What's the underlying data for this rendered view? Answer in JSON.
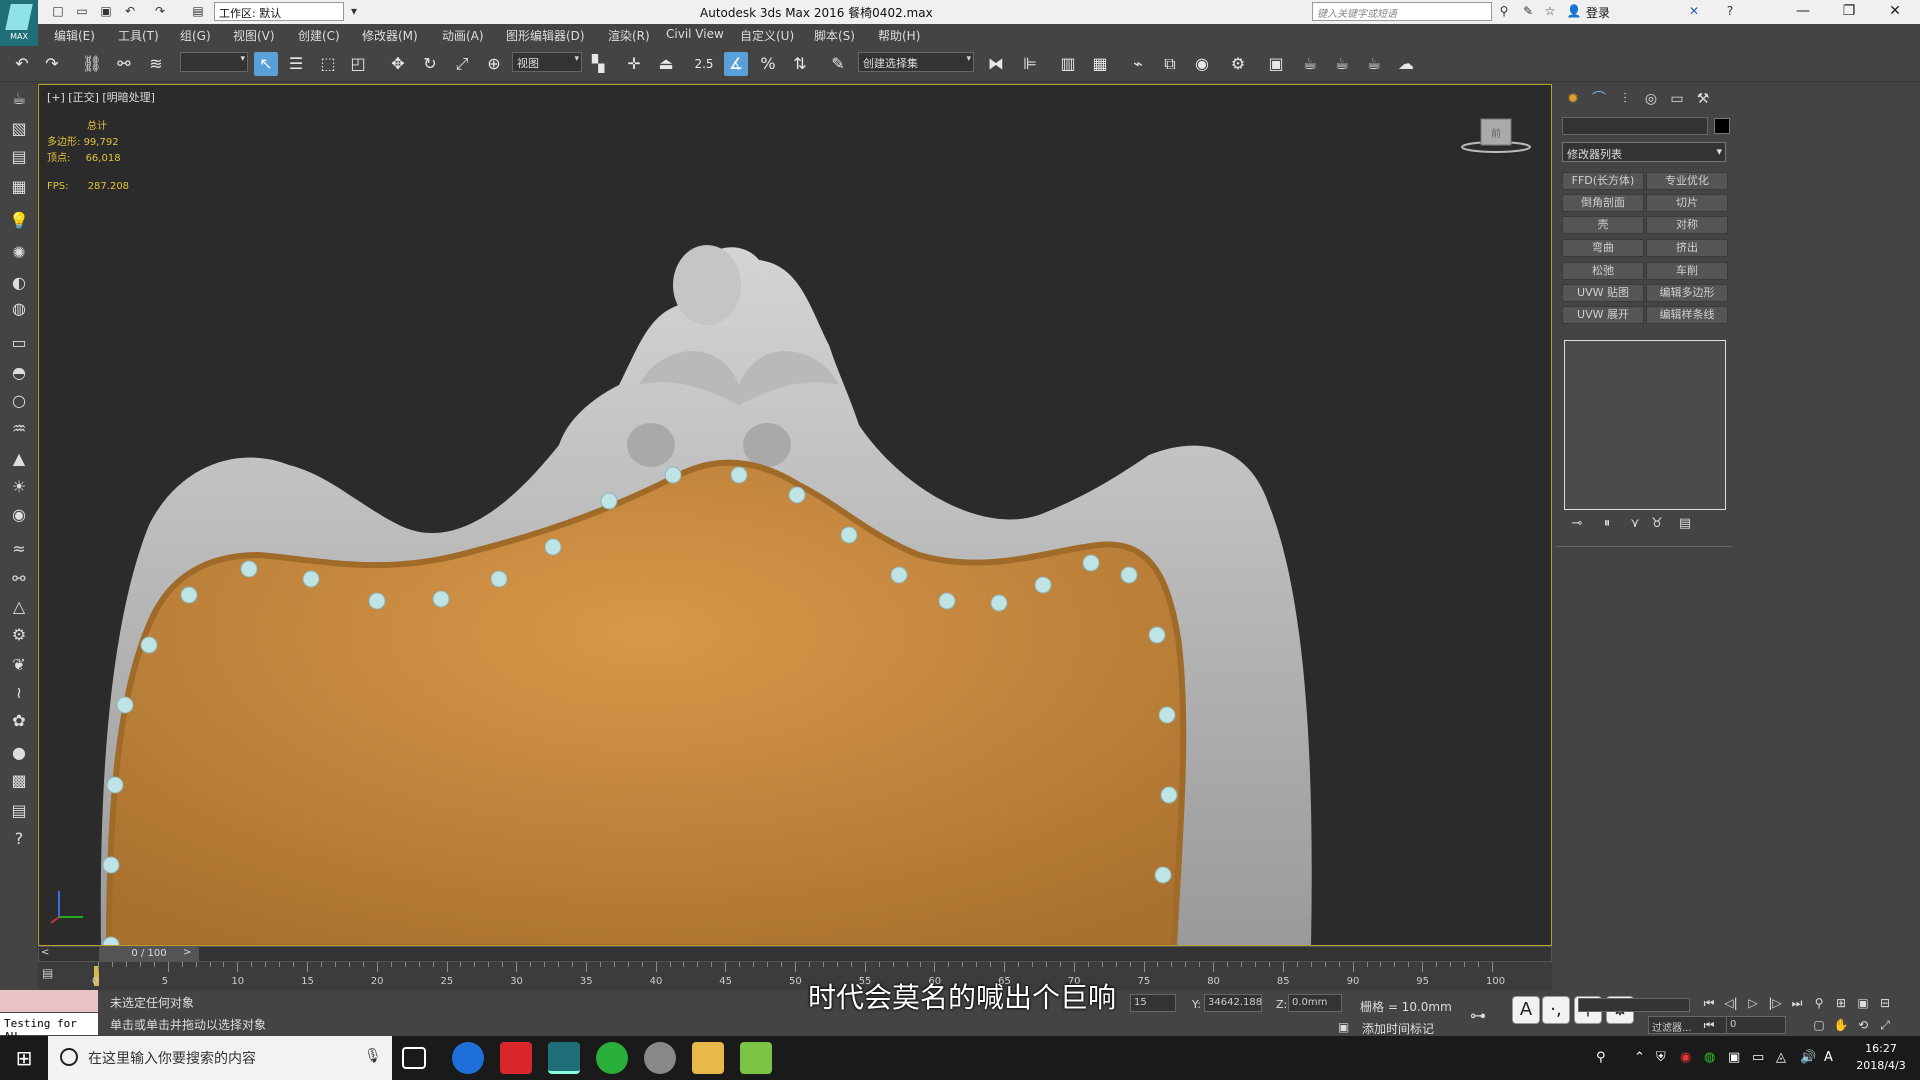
{
  "titlebar": {
    "workspace": "工作区: 默认",
    "title": "Autodesk 3ds Max 2016       餐椅0402.max",
    "search_placeholder": "键入关键字或短语",
    "login": "登录",
    "logo_text": "MAX"
  },
  "menu": [
    "编辑(E)",
    "工具(T)",
    "组(G)",
    "视图(V)",
    "创建(C)",
    "修改器(M)",
    "动画(A)",
    "图形编辑器(D)",
    "渲染(R)",
    "Civil View",
    "自定义(U)",
    "脚本(S)",
    "帮助(H)"
  ],
  "toolbar": {
    "view_dropdown": "视图",
    "snap_value": "2.5",
    "selection_set": "创建选择集"
  },
  "viewport": {
    "label": "[+] [正交] [明暗处理]",
    "stats_header": "总计",
    "polys_label": "多边形:",
    "polys": "99,792",
    "verts_label": "顶点:",
    "verts": "66,018",
    "fps_label": "FPS:",
    "fps": "287.208",
    "viewcube_label": "前"
  },
  "command_panel": {
    "modifier_list": "修改器列表",
    "buttons": [
      "FFD(长方体)",
      "专业优化",
      "倒角剖面",
      "切片",
      "壳",
      "对称",
      "弯曲",
      "挤出",
      "松弛",
      "车削",
      "UVW 贴图",
      "编辑多边形",
      "UVW 展开",
      "编辑样条线"
    ]
  },
  "timeline": {
    "frame": "0 / 100",
    "ticks": [
      "0",
      "5",
      "10",
      "15",
      "20",
      "25",
      "30",
      "35",
      "40",
      "45",
      "50",
      "55",
      "60",
      "65",
      "70",
      "75",
      "80",
      "85",
      "90",
      "95",
      "100"
    ]
  },
  "status": {
    "line1": "未选定任何对象",
    "line2": "单击或单击并拖动以选择对象",
    "testing": "Testing for AU",
    "x_val": "15",
    "y_label": "Y:",
    "y_val": "34642.188",
    "z_label": "Z:",
    "z_val": "0.0mm",
    "grid": "栅格 = 10.0mm",
    "add_time_tag": "添加时间标记",
    "filter": "过滤器...",
    "frame_input": "0"
  },
  "subtitle": "时代会莫名的喊出个巨响",
  "taskbar": {
    "search_placeholder": "在这里输入你要搜索的内容",
    "time": "16:27",
    "date": "2018/4/3"
  },
  "colors": {
    "viewport_bg": "#2b2b2b",
    "viewport_border": "#b7a12e",
    "stats_text": "#e3c33a",
    "leather": "#c98a3a",
    "frame_gray": "#bdbdbd",
    "stud": "#bfe4e6"
  }
}
